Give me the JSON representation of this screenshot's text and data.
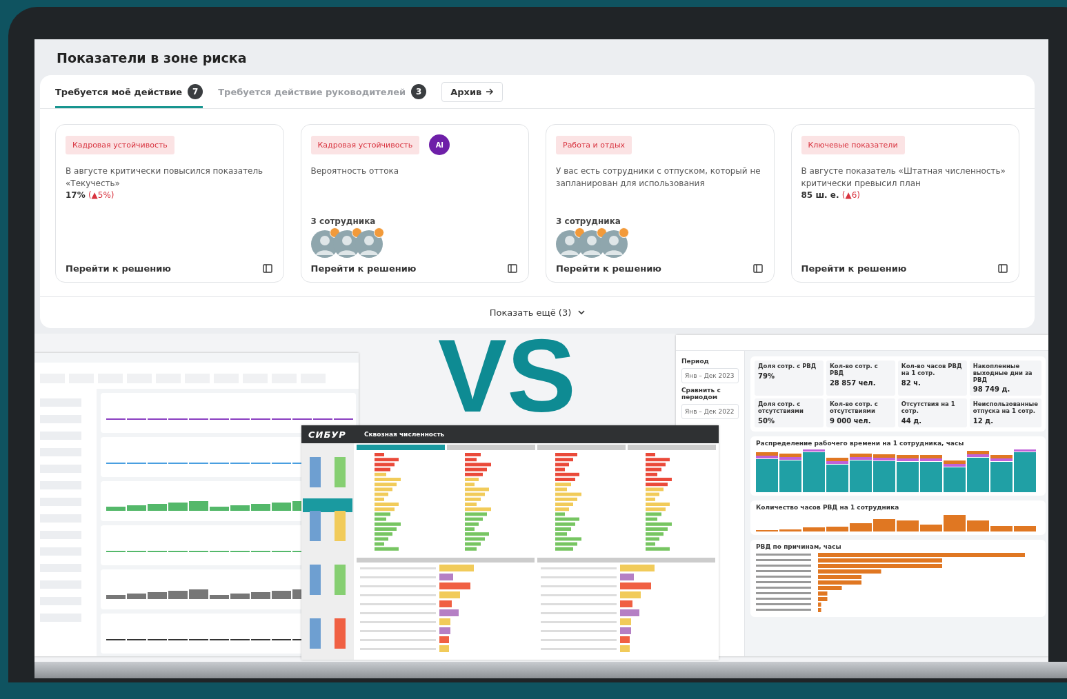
{
  "panel": {
    "title": "Показатели в зоне риска",
    "tabs": [
      {
        "label": "Требуется моё действие",
        "count": "7",
        "selected": true
      },
      {
        "label": "Требуется действие руководителей",
        "count": "3",
        "selected": false
      }
    ],
    "archive_button": "Архив",
    "cards": [
      {
        "tag": "Кадровая устойчивость",
        "text": "В августе критически повысился показатель «Текучесть»",
        "metric": "17%",
        "delta": "(▲5%)",
        "action": "Перейти к решению"
      },
      {
        "tag": "Кадровая устойчивость",
        "ai_badge": "AI",
        "text": "Вероятность оттока",
        "employees": "3 сотрудника",
        "avatars": [
          {
            "alert": true
          },
          {
            "alert": true
          },
          {
            "alert": true
          }
        ],
        "action": "Перейти к решению"
      },
      {
        "tag": "Работа и отдых",
        "text": "У вас есть сотрудники с отпуском, который не запланирован для использования",
        "employees": "3 сотрудника",
        "avatars": [
          {
            "alert": true
          },
          {
            "alert": true
          },
          {
            "alert": true
          }
        ],
        "action": "Перейти к решению"
      },
      {
        "tag": "Ключевые показатели",
        "text": "В августе показатель «Штатная численность» критически превысил план",
        "metric": "85 ш. е.",
        "delta": "(▲6)",
        "action": "Перейти к решению"
      }
    ],
    "show_more": "Показать ещё (3)"
  },
  "overlay_text": "VS",
  "sibur_screen": {
    "logo": "СИБУР",
    "title": "Сквозная численность"
  },
  "rest_screen": {
    "period_label": "Период",
    "period_value": "Янв – Дек 2023",
    "compare_label": "Сравнить с периодом",
    "compare_value": "Янв – Дек 2022",
    "kpis": [
      {
        "label": "Доля сотр. с РВД",
        "value": "79%"
      },
      {
        "label": "Кол-во сотр. с РВД",
        "value": "28 857 чел."
      },
      {
        "label": "Кол-во часов РВД на 1 сотр.",
        "value": "82 ч."
      },
      {
        "label": "Накопленные выходные дни за РВД",
        "value": "98 749 д."
      },
      {
        "label": "Доля сотр. с отсутствиями",
        "value": "50%"
      },
      {
        "label": "Кол-во сотр. с отсутствиями",
        "value": "9 000 чел."
      },
      {
        "label": "Отсутствия на 1 сотр.",
        "value": "44 д."
      },
      {
        "label": "Неиспользованные отпуска на 1 сотр.",
        "value": "12 д."
      }
    ],
    "charts": [
      {
        "kind": "stacked",
        "title": "Распределение рабочего времени на 1 сотрудника, часы"
      },
      {
        "kind": "bars",
        "title": "Количество часов РВД на 1 сотрудника"
      },
      {
        "kind": "hbars",
        "title": "РВД по причинам, часы"
      }
    ]
  }
}
